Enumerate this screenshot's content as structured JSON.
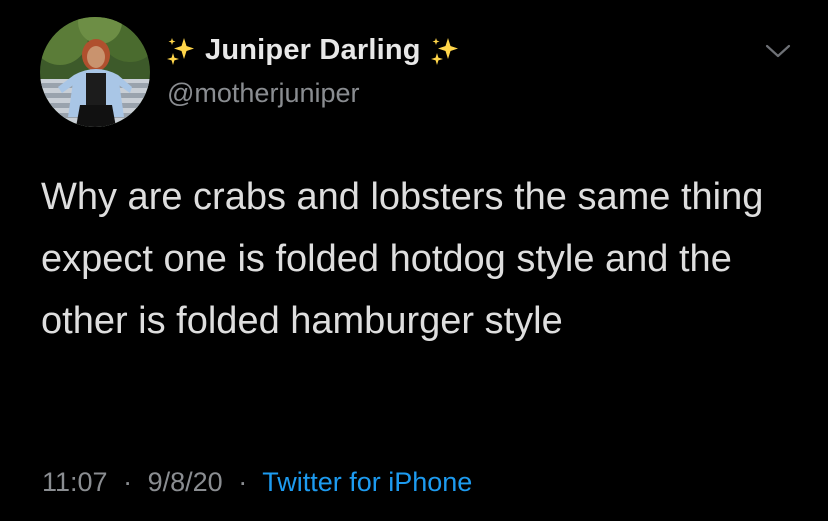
{
  "tweet": {
    "author": {
      "display_name": "Juniper Darling",
      "handle": "@motherjuniper",
      "avatar_icon": "profile-photo",
      "name_decoration_icon": "sparkles-icon"
    },
    "text": "Why are crabs and lobsters the same thing expect one is folded hotdog style and the other is folded hamburger style",
    "meta": {
      "time": "11:07",
      "date": "9/8/20",
      "separator": "·",
      "source": "Twitter for iPhone"
    },
    "menu_icon": "chevron-down-icon"
  },
  "colors": {
    "background": "#000000",
    "text_primary": "#dedede",
    "text_secondary": "#8a8d91",
    "link": "#1d9bf0",
    "sparkle": "#ffd54a"
  }
}
